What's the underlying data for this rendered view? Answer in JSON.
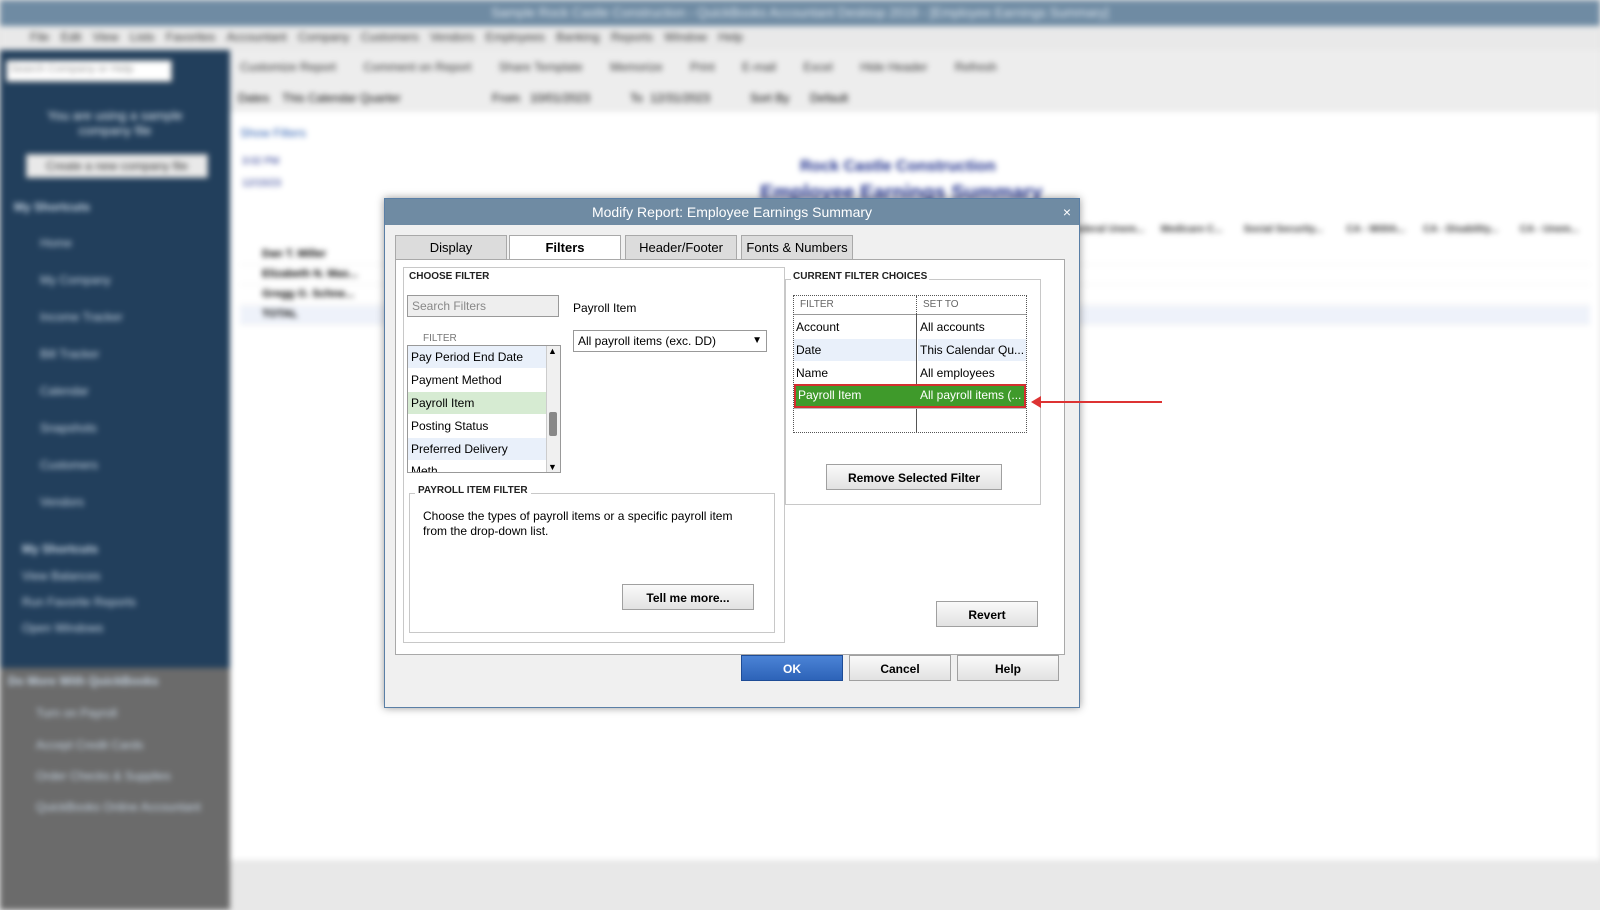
{
  "background": {
    "window_title": "Sample Rock Castle Construction - QuickBooks Accountant Desktop 2019 - [Employee Earnings Summary]",
    "menu": [
      "File",
      "Edit",
      "View",
      "Lists",
      "Favorites",
      "Accountant",
      "Company",
      "Customers",
      "Vendors",
      "Employees",
      "Banking",
      "Reports",
      "Window",
      "Help"
    ],
    "sidebar_search_placeholder": "Search Company or Help",
    "sidebar_notice": "You are using a sample company file",
    "create_company_button": "Create a new company file",
    "my_shortcuts_label": "My Shortcuts",
    "shortcuts": [
      "Home",
      "My Company",
      "Income Tracker",
      "Bill Tracker",
      "Calendar",
      "Snapshots",
      "Customers",
      "Vendors"
    ],
    "lower_items": [
      "My Shortcuts",
      "View Balances",
      "Run Favorite Reports",
      "Open Windows"
    ],
    "do_more_label": "Do More With QuickBooks",
    "do_more_items": [
      "Turn on Payroll",
      "Accept Credit Cards",
      "Order Checks & Supplies",
      "QuickBooks Online Accountant"
    ],
    "toolbar": [
      "Customize Report",
      "Comment on Report",
      "Share Template",
      "Memorize",
      "Print",
      "E-mail",
      "Excel",
      "Hide Header",
      "Refresh"
    ],
    "filterbar_dates_label": "Dates",
    "filterbar_dates_value": "This Calendar Quarter",
    "filterbar_from_label": "From",
    "filterbar_from_value": "10/01/2023",
    "filterbar_to_label": "To",
    "filterbar_to_value": "12/31/2023",
    "filterbar_sort_label": "Sort By",
    "filterbar_sort_value": "Default",
    "show_filters": "Show Filters",
    "report_time": "3:02 PM",
    "report_date": "12/15/23",
    "report_company": "Rock Castle Construction",
    "report_title": "Employee Earnings Summary",
    "report_columns": [
      "Federal Unem...",
      "Medicare C...",
      "Social Security...",
      "CA - Withh...",
      "CA - Disability...",
      "CA - Unem..."
    ],
    "report_rows": [
      "Dan T. Miller",
      "Elizabeth N. Mas...",
      "Gregg O. Schne...",
      "TOTAL"
    ]
  },
  "dialog": {
    "title": "Modify Report: Employee Earnings Summary",
    "close_glyph": "×",
    "tabs": [
      "Display",
      "Filters",
      "Header/Footer",
      "Fonts & Numbers"
    ],
    "choose_filter_label": "CHOOSE FILTER",
    "search_placeholder": "Search Filters",
    "filter_col_label": "FILTER",
    "filter_items": [
      "Pay Period End Date",
      "Payment Method",
      "Payroll Item",
      "Posting Status",
      "Preferred Delivery Meth..."
    ],
    "selected_filter_name": "Payroll Item",
    "selected_filter_value": "All payroll items (exc. DD)",
    "payroll_item_filter_label": "PAYROLL ITEM FILTER",
    "payroll_item_filter_desc": "Choose the types of payroll items or a specific payroll item from the drop-down list.",
    "tell_me_more": "Tell me more...",
    "current_choices_label": "CURRENT FILTER CHOICES",
    "choices_header_filter": "FILTER",
    "choices_header_setto": "SET TO",
    "choices": [
      {
        "filter": "Account",
        "set_to": "All accounts"
      },
      {
        "filter": "Date",
        "set_to": "This Calendar Qu..."
      },
      {
        "filter": "Name",
        "set_to": "All employees"
      },
      {
        "filter": "Payroll Item",
        "set_to": "All payroll items (..."
      }
    ],
    "remove_selected_filter": "Remove Selected Filter",
    "revert": "Revert",
    "ok": "OK",
    "cancel": "Cancel",
    "help": "Help"
  },
  "colors": {
    "highlight_green": "#3f9a2b",
    "highlight_border": "#d32f2f",
    "selected_list_bg": "#d6ebd2",
    "accent_blue": "#2d63b8"
  }
}
